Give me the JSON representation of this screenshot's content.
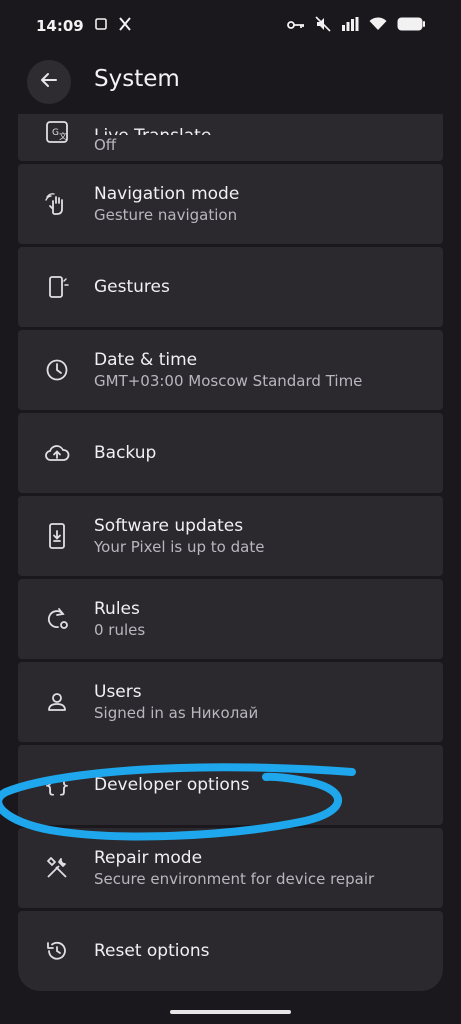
{
  "status_bar": {
    "time": "14:09",
    "left_icons": [
      "screen-record-icon",
      "x-app-icon"
    ],
    "right_icons": [
      "vpn-key-icon",
      "mute-icon",
      "signal-icon",
      "wifi-icon",
      "battery-icon"
    ]
  },
  "header": {
    "title": "System",
    "back_icon": "arrow-left-icon"
  },
  "settings": [
    {
      "id": "live-translate",
      "title": "Live Translate",
      "subtitle": "Off",
      "icon": "translate-icon"
    },
    {
      "id": "navigation-mode",
      "title": "Navigation mode",
      "subtitle": "Gesture navigation",
      "icon": "gesture-hand-icon"
    },
    {
      "id": "gestures",
      "title": "Gestures",
      "subtitle": "",
      "icon": "phone-gesture-icon"
    },
    {
      "id": "date-time",
      "title": "Date & time",
      "subtitle": "GMT+03:00 Moscow Standard Time",
      "icon": "clock-icon"
    },
    {
      "id": "backup",
      "title": "Backup",
      "subtitle": "",
      "icon": "cloud-upload-icon"
    },
    {
      "id": "software-updates",
      "title": "Software updates",
      "subtitle": "Your Pixel is up to date",
      "icon": "system-update-icon"
    },
    {
      "id": "rules",
      "title": "Rules",
      "subtitle": "0 rules",
      "icon": "rules-icon"
    },
    {
      "id": "users",
      "title": "Users",
      "subtitle": "Signed in as Николай",
      "icon": "person-icon"
    },
    {
      "id": "developer-options",
      "title": "Developer options",
      "subtitle": "",
      "icon": "braces-icon"
    },
    {
      "id": "repair-mode",
      "title": "Repair mode",
      "subtitle": "Secure environment for device repair",
      "icon": "repair-tools-icon"
    },
    {
      "id": "reset-options",
      "title": "Reset options",
      "subtitle": "",
      "icon": "history-icon"
    }
  ],
  "colors": {
    "background": "#1a181c",
    "card": "#2b292e",
    "annotation": "#1ea7ec"
  }
}
